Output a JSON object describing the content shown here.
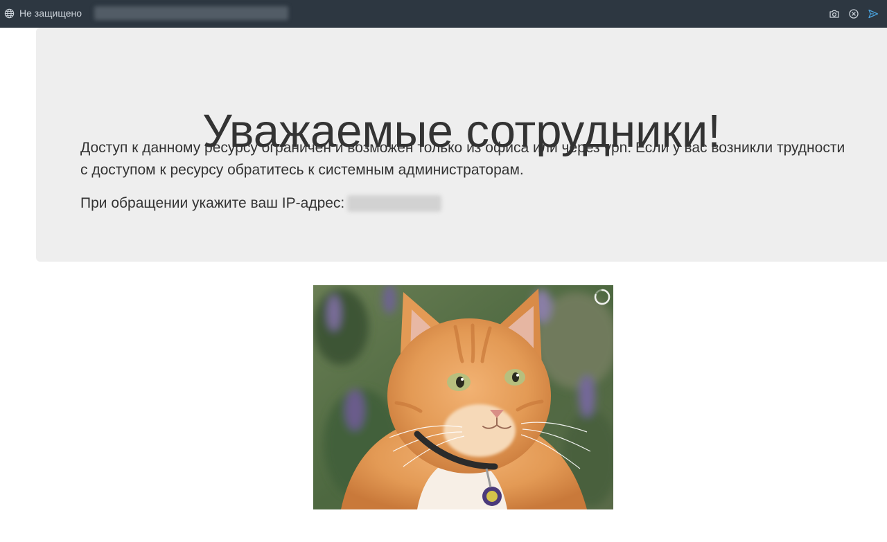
{
  "browser": {
    "security_label": "Не защищено",
    "icons": [
      "globe-icon",
      "camera-icon",
      "close-circle-icon",
      "send-icon"
    ],
    "colors": {
      "toolbar_bg": "#2d3741",
      "toolbar_text": "#ccd3da",
      "send_accent": "#4aa3df"
    }
  },
  "notice": {
    "heading": "Уважаемые сотрудники!",
    "paragraph": "Доступ к данному ресурсу ограничен и возможен только из офиса или через vpn. Если у вас возникли трудности с доступом к ресурсу обратитесь к системным администраторам.",
    "ip_label": "При обращении укажите ваш IP-адрес:"
  },
  "image": {
    "icon": "loading-spinner-icon"
  },
  "colors": {
    "page_bg": "#ffffff",
    "panel_bg": "#eeeeee",
    "text": "#333333"
  }
}
